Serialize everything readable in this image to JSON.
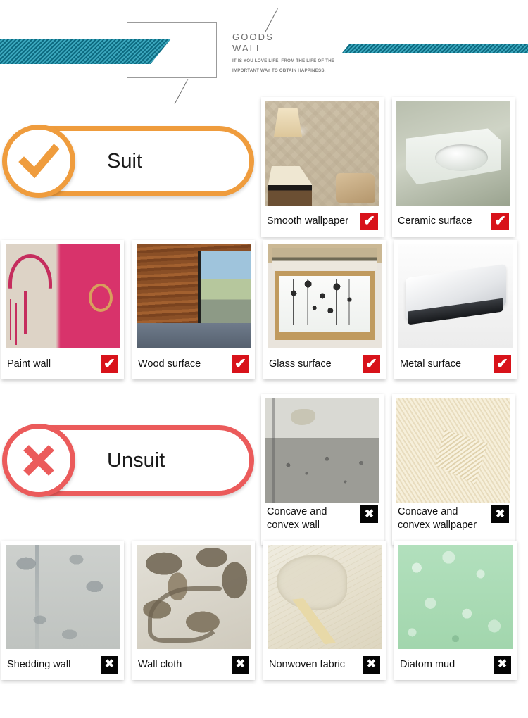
{
  "header": {
    "title_line1": "GOODS",
    "title_line2": "WALL",
    "subtitle_line1": "IT IS YOU LOVE LIFE, FROM THE LIFE OF THE",
    "subtitle_line2": "IMPORTANT WAY TO OBTAIN HAPPINESS.",
    "banner_color": "#0d6a80",
    "frame_color": "#9b9b9b"
  },
  "sections": [
    {
      "id": "suit",
      "label": "Suit",
      "badge_icon": "check-icon",
      "accent_color": "#ef9c3d",
      "mark_color": "#d8121a",
      "mark_glyph": "✔"
    },
    {
      "id": "unsuit",
      "label": "Unsuit",
      "badge_icon": "cross-icon",
      "accent_color": "#eb5b5b",
      "mark_color": "#050505",
      "mark_glyph": "✖"
    }
  ],
  "suit_cards_row1": [
    {
      "label": "Smooth wallpaper",
      "mark": "✔",
      "photo": "smooth-wallpaper-photo"
    },
    {
      "label": "Ceramic surface",
      "mark": "✔",
      "photo": "ceramic-surface-photo"
    }
  ],
  "suit_cards_row2": [
    {
      "label": "Paint wall",
      "mark": "✔",
      "photo": "paint-wall-photo"
    },
    {
      "label": "Wood surface",
      "mark": "✔",
      "photo": "wood-surface-photo"
    },
    {
      "label": "Glass surface",
      "mark": "✔",
      "photo": "glass-surface-photo"
    },
    {
      "label": "Metal surface",
      "mark": "✔",
      "photo": "metal-surface-photo"
    }
  ],
  "unsuit_cards_row1": [
    {
      "label": "Concave and convex wall",
      "mark": "✖",
      "photo": "concave-convex-wall-photo"
    },
    {
      "label": "Concave and convex wallpaper",
      "mark": "✖",
      "photo": "concave-convex-wallpaper-photo"
    }
  ],
  "unsuit_cards_row2": [
    {
      "label": "Shedding wall",
      "mark": "✖",
      "photo": "shedding-wall-photo"
    },
    {
      "label": "Wall cloth",
      "mark": "✖",
      "photo": "wall-cloth-photo"
    },
    {
      "label": "Nonwoven fabric",
      "mark": "✖",
      "photo": "nonwoven-fabric-photo"
    },
    {
      "label": "Diatom mud",
      "mark": "✖",
      "photo": "diatom-mud-photo"
    }
  ]
}
